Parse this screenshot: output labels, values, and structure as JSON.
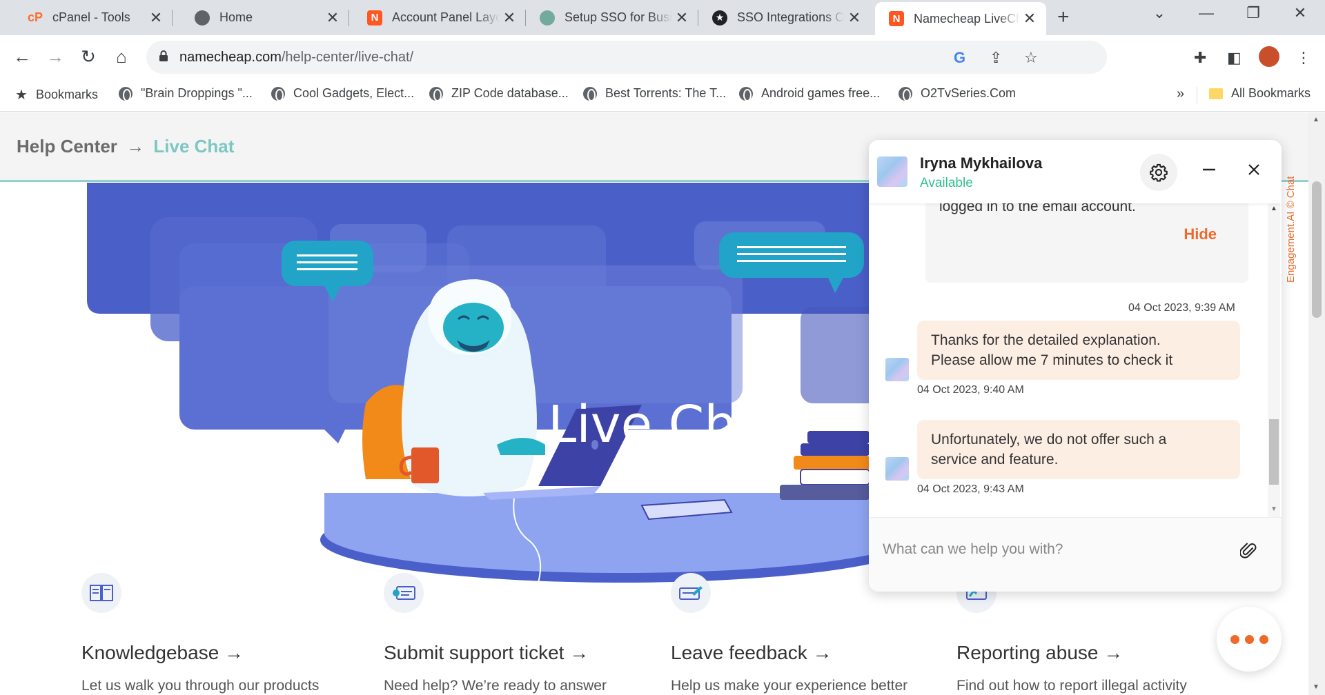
{
  "browser": {
    "tabs": [
      {
        "title": "cPanel - Tools",
        "icon": "cpanel-icon"
      },
      {
        "title": "Home",
        "icon": "globe-icon"
      },
      {
        "title": "Account Panel Layout",
        "icon": "namecheap-icon"
      },
      {
        "title": "Setup SSO for Business",
        "icon": "chatgpt-icon"
      },
      {
        "title": "SSO Integrations C",
        "icon": "auth0-icon"
      },
      {
        "title": "Namecheap LiveChat",
        "icon": "namecheap-icon",
        "active": true
      }
    ],
    "url_host": "namecheap.com",
    "url_path": "/help-center/live-chat/",
    "bookmarks": [
      {
        "label": "Bookmarks",
        "icon": "star-icon"
      },
      {
        "label": "\"Brain Droppings \"...",
        "icon": "globe-icon"
      },
      {
        "label": "Cool Gadgets, Elect...",
        "icon": "globe-icon"
      },
      {
        "label": "ZIP Code database...",
        "icon": "globe-icon"
      },
      {
        "label": "Best Torrents: The T...",
        "icon": "globe-icon"
      },
      {
        "label": "Android games free...",
        "icon": "globe-icon"
      },
      {
        "label": "O2TvSeries.Com",
        "icon": "globe-icon"
      }
    ],
    "bookmarks_overflow": "»",
    "all_bookmarks": "All Bookmarks"
  },
  "page": {
    "breadcrumb_root": "Help Center",
    "breadcrumb_arrow": "→",
    "breadcrumb_current": "Live Chat",
    "hero_title": "Live Chat",
    "features": [
      {
        "title": "Knowledgebase →",
        "desc": "Let us walk you through our products",
        "icon": "book-icon"
      },
      {
        "title": "Submit support ticket →",
        "desc": "Need help? We’re ready to answer",
        "icon": "ticket-icon"
      },
      {
        "title": "Leave feedback →",
        "desc": "Help us make your experience better",
        "icon": "feedback-icon"
      },
      {
        "title": "Reporting abuse →",
        "desc": "Find out how to report illegal activity",
        "icon": "abuse-icon"
      }
    ]
  },
  "chat": {
    "agent_name": "Iryna Mykhailova",
    "agent_status": "Available",
    "card_text": "logged in to the email account.",
    "hide_label": "Hide",
    "card_time": "04 Oct 2023, 9:39 AM",
    "messages": [
      {
        "line1": "Thanks for the detailed explanation.",
        "line2": "Please allow me 7 minutes to check it",
        "time": "04 Oct 2023, 9:40 AM"
      },
      {
        "line1": "Unfortunately, we do not offer such a",
        "line2": "service and feature.",
        "time": "04 Oct 2023, 9:43 AM"
      }
    ],
    "input_placeholder": "What can we help you with?",
    "brand_vertical": "Engagement.AI © Chat"
  },
  "colors": {
    "accent_orange": "#ee6a2c",
    "status_green": "#2fbf8f",
    "hero_blue": "#4a5fc9",
    "breadcrumb_teal": "#7dc7c3"
  }
}
